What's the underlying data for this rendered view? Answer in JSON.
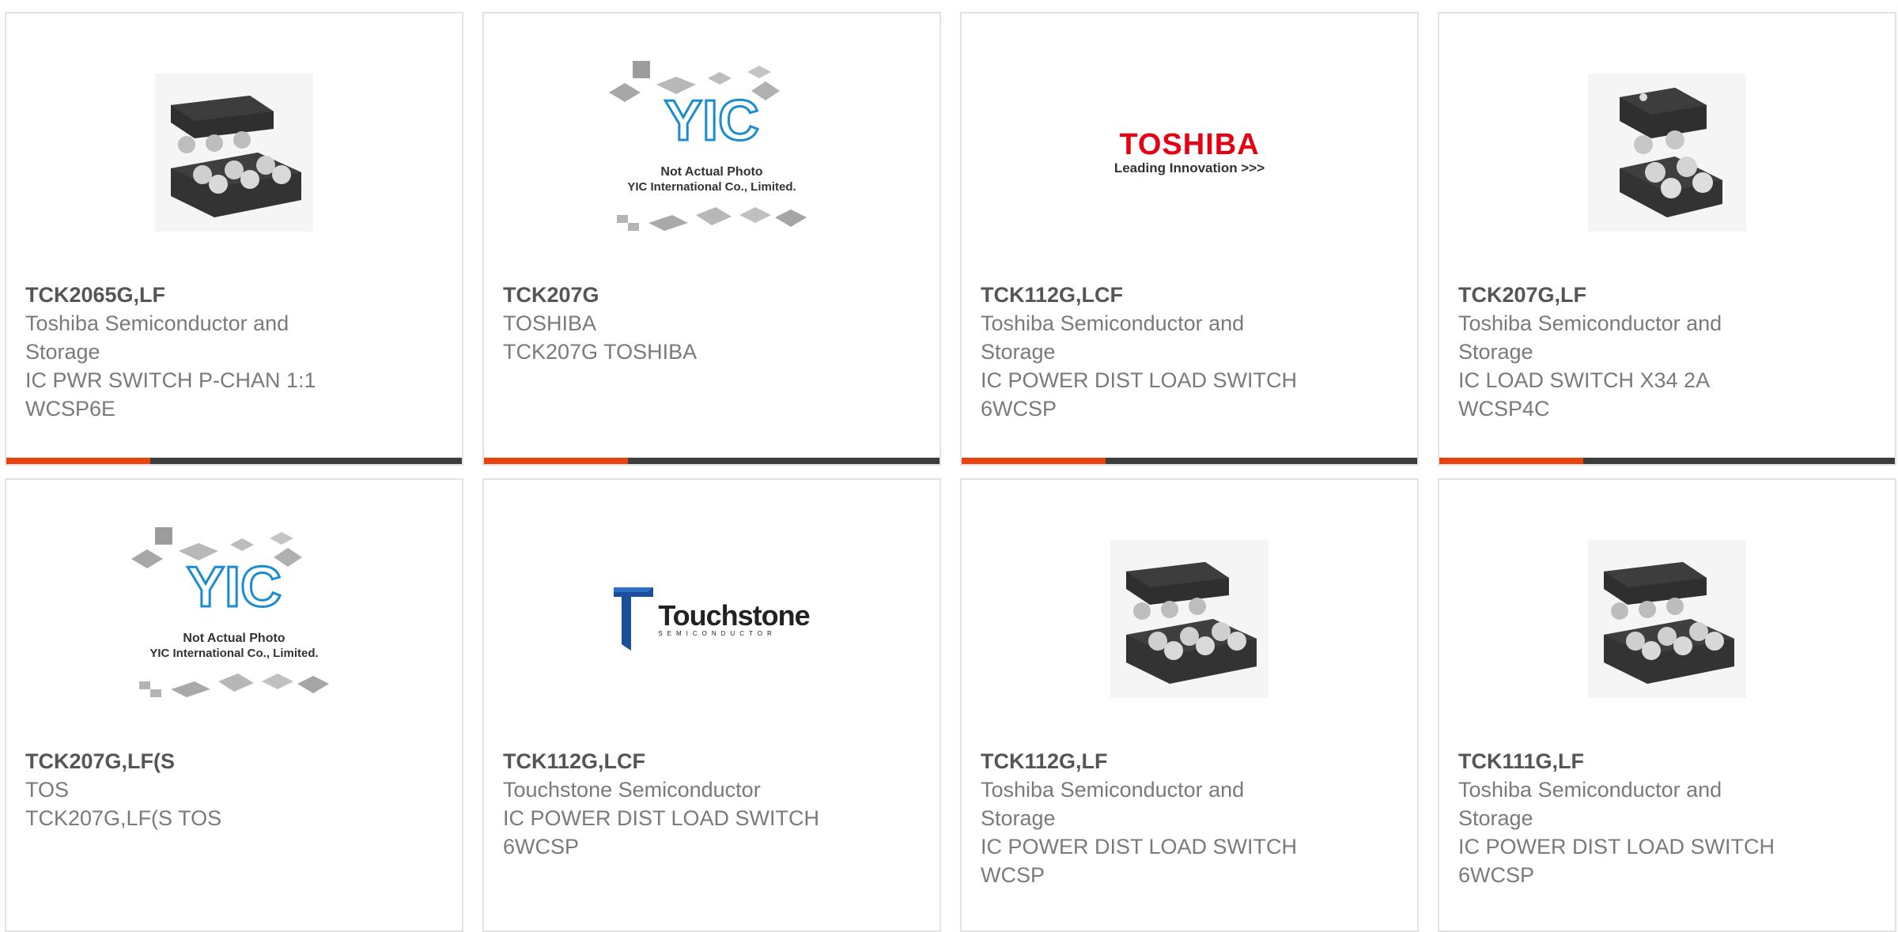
{
  "products": [
    {
      "part_number": "TCK2065G,LF",
      "manufacturer": [
        "Toshiba Semiconductor and",
        "Storage"
      ],
      "description": [
        "IC PWR SWITCH P-CHAN 1:1",
        "WCSP6E"
      ],
      "image": "chip-6ball-icon"
    },
    {
      "part_number": "TCK207G",
      "manufacturer": [
        "TOSHIBA"
      ],
      "description": [
        "TCK207G TOSHIBA"
      ],
      "image": "yic-placeholder-icon",
      "image_text": [
        "Not Actual Photo",
        "YIC International Co., Limited."
      ]
    },
    {
      "part_number": "TCK112G,LCF",
      "manufacturer": [
        "Toshiba Semiconductor and",
        "Storage"
      ],
      "description": [
        "IC POWER DIST LOAD SWITCH",
        "6WCSP"
      ],
      "image": "toshiba-logo",
      "image_text": [
        "TOSHIBA",
        "Leading Innovation >>>"
      ]
    },
    {
      "part_number": "TCK207G,LF",
      "manufacturer": [
        "Toshiba Semiconductor and",
        "Storage"
      ],
      "description": [
        "IC LOAD SWITCH X34 2A",
        "WCSP4C"
      ],
      "image": "chip-4ball-icon"
    },
    {
      "part_number": "TCK207G,LF(S",
      "manufacturer": [
        "TOS"
      ],
      "description": [
        "TCK207G,LF(S TOS"
      ],
      "image": "yic-placeholder-icon",
      "image_text": [
        "Not Actual Photo",
        "YIC International Co., Limited."
      ]
    },
    {
      "part_number": "TCK112G,LCF",
      "manufacturer": [
        "Touchstone Semiconductor"
      ],
      "description": [
        "IC POWER DIST LOAD SWITCH",
        "6WCSP"
      ],
      "image": "touchstone-logo",
      "image_text": [
        "Touchstone",
        "SEMICONDUCTOR"
      ]
    },
    {
      "part_number": "TCK112G,LF",
      "manufacturer": [
        "Toshiba Semiconductor and",
        "Storage"
      ],
      "description": [
        "IC POWER DIST LOAD SWITCH",
        "WCSP"
      ],
      "image": "chip-6ball-icon"
    },
    {
      "part_number": "TCK111G,LF",
      "manufacturer": [
        "Toshiba Semiconductor and",
        "Storage"
      ],
      "description": [
        "IC POWER DIST LOAD SWITCH",
        "6WCSP"
      ],
      "image": "chip-6ball-icon"
    }
  ],
  "colors": {
    "accent": "#e8430f",
    "bar": "#3c3c3c",
    "border": "#e3e3e3",
    "part_number": "#555555",
    "text": "#7a7a7a",
    "toshiba_red": "#e60012",
    "yic_blue": "#1a8ccf"
  }
}
